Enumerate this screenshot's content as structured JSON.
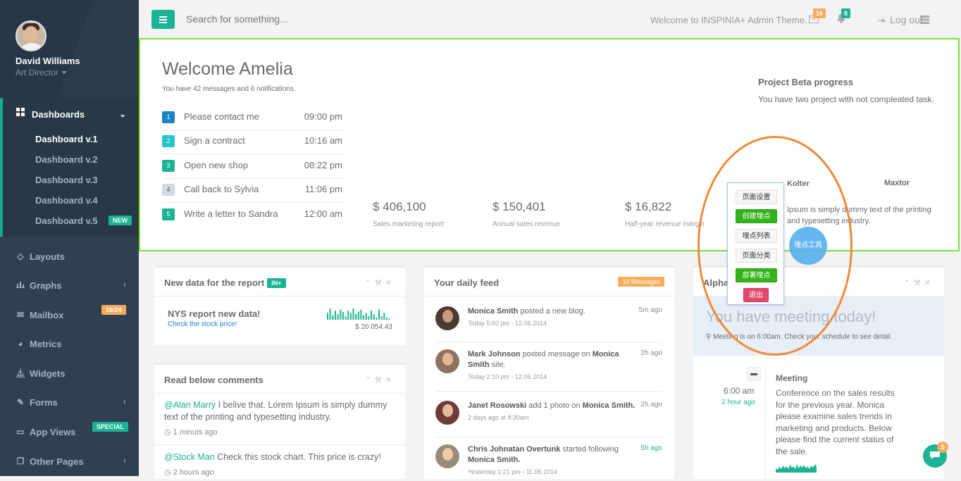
{
  "profile": {
    "name": "David Williams",
    "role": "Art Director"
  },
  "sidebar": {
    "dashboards_label": "Dashboards",
    "sub_items": [
      "Dashboard v.1",
      "Dashboard v.2",
      "Dashboard v.3",
      "Dashboard v.4",
      "Dashboard v.5"
    ],
    "new_badge": "NEW",
    "items": [
      {
        "label": "Layouts",
        "icon": "diamond-icon"
      },
      {
        "label": "Graphs",
        "icon": "bar-chart-icon"
      },
      {
        "label": "Mailbox",
        "icon": "envelope-icon",
        "badge": "16/24"
      },
      {
        "label": "Metrics",
        "icon": "pie-chart-icon"
      },
      {
        "label": "Widgets",
        "icon": "flask-icon"
      },
      {
        "label": "Forms",
        "icon": "edit-icon"
      },
      {
        "label": "App Views",
        "icon": "desktop-icon",
        "badge": "SPECIAL"
      },
      {
        "label": "Other Pages",
        "icon": "files-icon"
      }
    ]
  },
  "topbar": {
    "search_placeholder": "Search for something...",
    "welcome": "Welcome to INSPINIA+ Admin Theme.",
    "mail_count": "16",
    "bell_count": "8",
    "logout": "Log out"
  },
  "welcome": {
    "title": "Welcome Amelia",
    "subtitle": "You have 42 messages and 6 notifications.",
    "todos": [
      {
        "num": "1",
        "text": "Please contact me",
        "time": "09:00 pm",
        "color": "#1c84c6"
      },
      {
        "num": "2",
        "text": "Sign a contract",
        "time": "10:16 am",
        "color": "#23c6c8"
      },
      {
        "num": "3",
        "text": "Open new shop",
        "time": "08:22 pm",
        "color": "#1ab394"
      },
      {
        "num": "4",
        "text": "Call back to Sylvia",
        "time": "11:06 pm",
        "color": "#d1dade"
      },
      {
        "num": "5",
        "text": "Write a letter to Sandra",
        "time": "12:00 am",
        "color": "#1ab394"
      }
    ],
    "stats": [
      {
        "value": "$ 406,100",
        "label": "Sales marketing report"
      },
      {
        "value": "$ 150,401",
        "label": "Annual sales revenue"
      },
      {
        "value": "$ 16,822",
        "label": "Half-year revenue margin"
      }
    ],
    "project_title": "Project Beta progress",
    "project_desc": "You have two project with not compleated task.",
    "brands": [
      "Kolter",
      "Maxtor"
    ],
    "lorem": "Ipsum is simply dummy text of the printing and typesetting industry."
  },
  "popup": {
    "buttons": [
      "页面设置",
      "创建埋点",
      "埋点列表",
      "页面分类",
      "部署埋点",
      "退出"
    ],
    "tool": "埋点工具"
  },
  "report": {
    "title": "New data for the report",
    "badge": "IN+",
    "headline": "NYS report new data!",
    "link": "Check the stock price!",
    "value": "$ 20 054.43",
    "spark": [
      0.6,
      1.0,
      0.4,
      0.8,
      0.5,
      0.9,
      0.7,
      0.3,
      0.8,
      0.6,
      1.0,
      0.5,
      0.7,
      0.9,
      0.4,
      0.6,
      0.3,
      0.8,
      0.5,
      0.2,
      0.9,
      0.3,
      0.6,
      0.2,
      0.1
    ]
  },
  "comments": {
    "title": "Read below comments",
    "items": [
      {
        "user": "@Alan Marry",
        "text": " I belive that. Lorem Ipsum is simply dummy text of the printing and typesetting industry.",
        "time": "1 minuts ago"
      },
      {
        "user": "@Stock Man",
        "text": " Check this stock chart. This price is crazy!",
        "time": "2 hours ago"
      }
    ]
  },
  "feed": {
    "title": "Your daily feed",
    "badge": "10 Messages",
    "items": [
      {
        "name": "Monica Smith",
        "rest": " posted a new blog.",
        "sub": "Today 5:60 pm - 12.06.2014",
        "ago": "5m ago",
        "green": false
      },
      {
        "name": "Mark Johnson",
        "rest": " posted message on ",
        "target": "Monica Smith",
        "tail": " site.",
        "sub": "Today 2:10 pm - 12.06.2014",
        "ago": "2h ago",
        "green": false
      },
      {
        "name": "Janet Rosowski",
        "rest": " add 1 photo on ",
        "target": "Monica Smith.",
        "tail": "",
        "sub": "2 days ago at 8:30am",
        "ago": "2h ago",
        "green": false
      },
      {
        "name": "Chris Johnatan Overtunk",
        "rest": " started following ",
        "target": "Monica Smith.",
        "tail": "",
        "sub": "Yesterday 1:21 pm - 11.06.2014",
        "ago": "5h ago",
        "green": true
      }
    ]
  },
  "alpha": {
    "title": "Alpha project",
    "meeting_today": "You have meeting today!",
    "meeting_note": "Meeting is on 6:00am. Check your schedule to see detail.",
    "time": "6:00 am",
    "ago": "2 hour ago",
    "meeting_title": "Meeting",
    "meeting_desc": "Conference on the sales results for the previous year. Monica please examine sales trends in marketing and products. Below please find the current status of the sale."
  },
  "chat_count": "5"
}
